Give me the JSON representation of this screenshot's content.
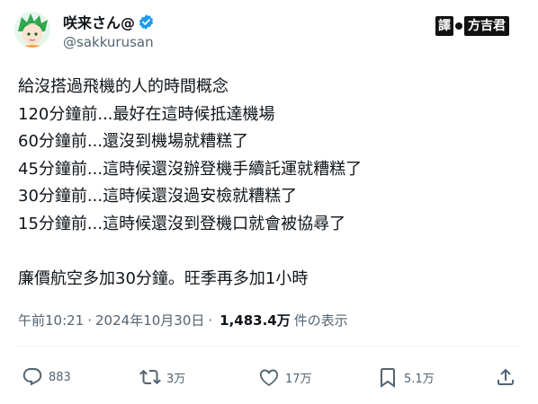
{
  "author": {
    "display_name": "咲来さん@",
    "handle": "@sakkurusan",
    "avatar_icon": "anime-avatar-icon",
    "verified_icon": "verified-badge-icon",
    "accent_color": "#1d9bf0"
  },
  "watermark": {
    "text_a": "譯",
    "text_b": "方吉君"
  },
  "tweet": {
    "lines": [
      "給沒搭過飛機的人的時間概念",
      "120分鐘前...最好在這時候抵達機場",
      "60分鐘前...還沒到機場就糟糕了",
      "45分鐘前...這時候還沒辦登機手續託運就糟糕了",
      "30分鐘前...這時候還沒過安檢就糟糕了",
      "15分鐘前...這時候還沒到登機口就會被協尋了",
      "廉價航空多加30分鐘。旺季再多加1小時"
    ]
  },
  "meta": {
    "time": "午前10:21",
    "separator": "·",
    "date": "2024年10月30日",
    "views": "1,483.4万",
    "views_label": "件の表示"
  },
  "actions": {
    "reply_count": "883",
    "retweet_count": "3万",
    "like_count": "17万",
    "bookmark_count": "5.1万"
  }
}
